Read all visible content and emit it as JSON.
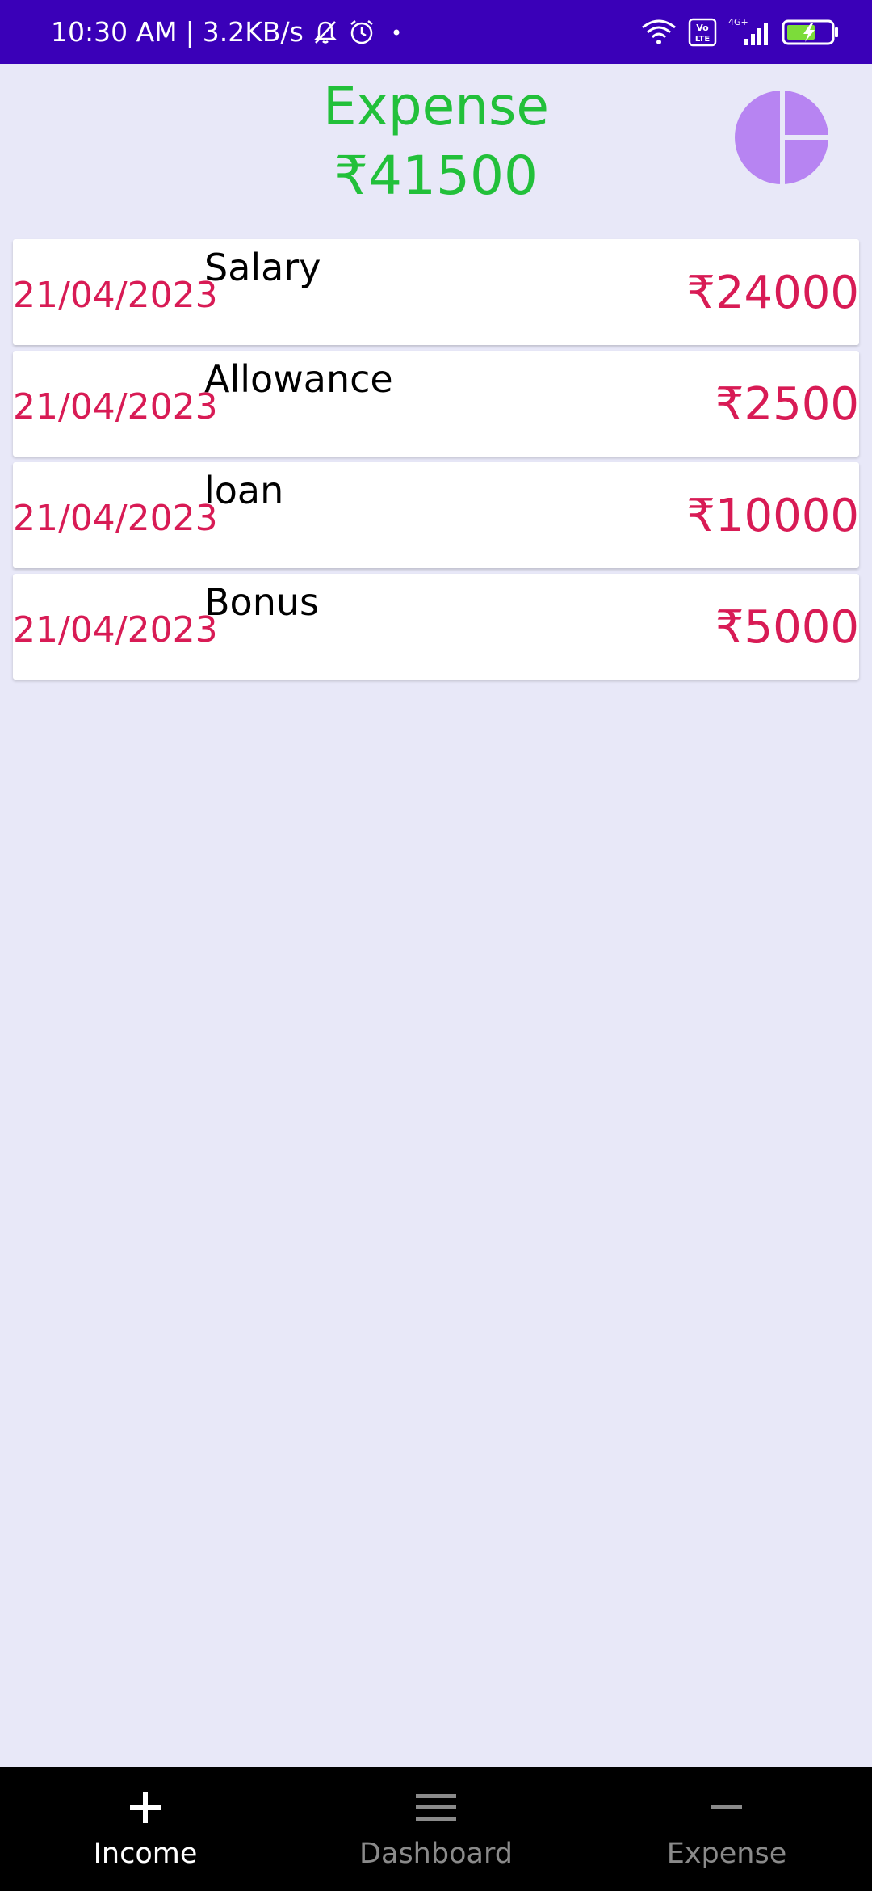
{
  "status_bar": {
    "time": "10:30 AM",
    "separator": "|",
    "network_speed": "3.2KB/s",
    "network_type": "4G+"
  },
  "header": {
    "title": "Expense",
    "total": "₹41500",
    "chart_icon": "pie-chart-icon",
    "chart_color": "#b784f2"
  },
  "transactions": [
    {
      "date": "21/04/2023",
      "name": "Salary",
      "amount": "₹24000"
    },
    {
      "date": "21/04/2023",
      "name": "Allowance",
      "amount": "₹2500"
    },
    {
      "date": "21/04/2023",
      "name": "loan",
      "amount": "₹10000"
    },
    {
      "date": "21/04/2023",
      "name": "Bonus",
      "amount": "₹5000"
    }
  ],
  "bottom_nav": {
    "items": [
      {
        "label": "Income",
        "icon": "plus-icon",
        "active": true
      },
      {
        "label": "Dashboard",
        "icon": "menu-icon",
        "active": false
      },
      {
        "label": "Expense",
        "icon": "minus-icon",
        "active": false
      }
    ]
  },
  "colors": {
    "status_bar": "#3a00b8",
    "background": "#e8e8f8",
    "header_text": "#22c03a",
    "transaction_accent": "#d81b55",
    "nav_background": "#000000"
  }
}
